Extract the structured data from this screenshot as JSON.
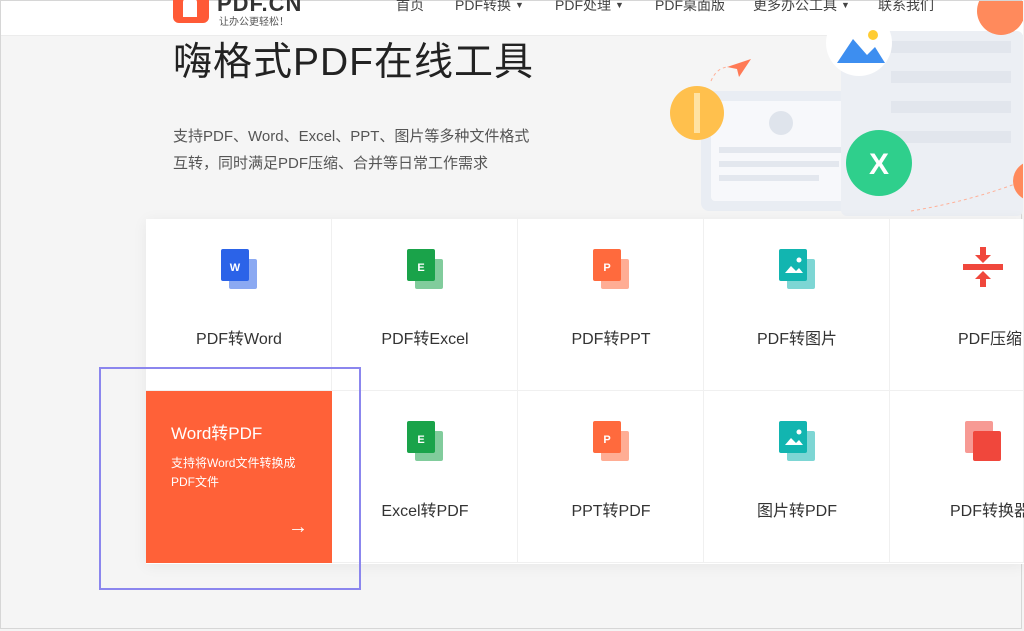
{
  "header": {
    "logo_text": "PDF.CN",
    "logo_slogan": "让办公更轻松！",
    "nav": [
      {
        "label": "首页",
        "dropdown": false
      },
      {
        "label": "PDF转换",
        "dropdown": true
      },
      {
        "label": "PDF处理",
        "dropdown": true
      },
      {
        "label": "PDF桌面版",
        "dropdown": false
      },
      {
        "label": "更多办公工具",
        "dropdown": true
      },
      {
        "label": "联系我们",
        "dropdown": false
      }
    ]
  },
  "hero": {
    "title": "嗨格式PDF在线工具",
    "description_line1": "支持PDF、Word、Excel、PPT、图片等多种文件格式",
    "description_line2": "互转，同时满足PDF压缩、合并等日常工作需求",
    "illustration_badge": "X"
  },
  "tools": {
    "row1": [
      {
        "label": "PDF转Word",
        "icon": "word-doc-icon",
        "badge": "W",
        "color": "#2b63e8"
      },
      {
        "label": "PDF转Excel",
        "icon": "excel-doc-icon",
        "badge": "E",
        "color": "#1aa34a"
      },
      {
        "label": "PDF转PPT",
        "icon": "ppt-doc-icon",
        "badge": "P",
        "color": "#ff6a3d"
      },
      {
        "label": "PDF转图片",
        "icon": "image-doc-icon",
        "badge": "",
        "color": "#12b5b0"
      },
      {
        "label": "PDF压缩",
        "icon": "compress-icon",
        "badge": "",
        "color": "#f0473c"
      }
    ],
    "row2_active": {
      "label": "Word转PDF",
      "description": "支持将Word文件转换成PDF文件",
      "arrow": "→"
    },
    "row2": [
      {
        "label": "Excel转PDF",
        "icon": "excel-doc-icon",
        "badge": "E",
        "color": "#1aa34a"
      },
      {
        "label": "PPT转PDF",
        "icon": "ppt-doc-icon",
        "badge": "P",
        "color": "#ff6a3d"
      },
      {
        "label": "图片转PDF",
        "icon": "image-doc-icon",
        "badge": "",
        "color": "#12b5b0"
      },
      {
        "label": "PDF转换器",
        "icon": "pdf-converter-icon",
        "badge": "",
        "color": "#f0473c"
      }
    ]
  },
  "colors": {
    "accent": "#ff6138",
    "highlight_outline": "#8b86ee"
  }
}
